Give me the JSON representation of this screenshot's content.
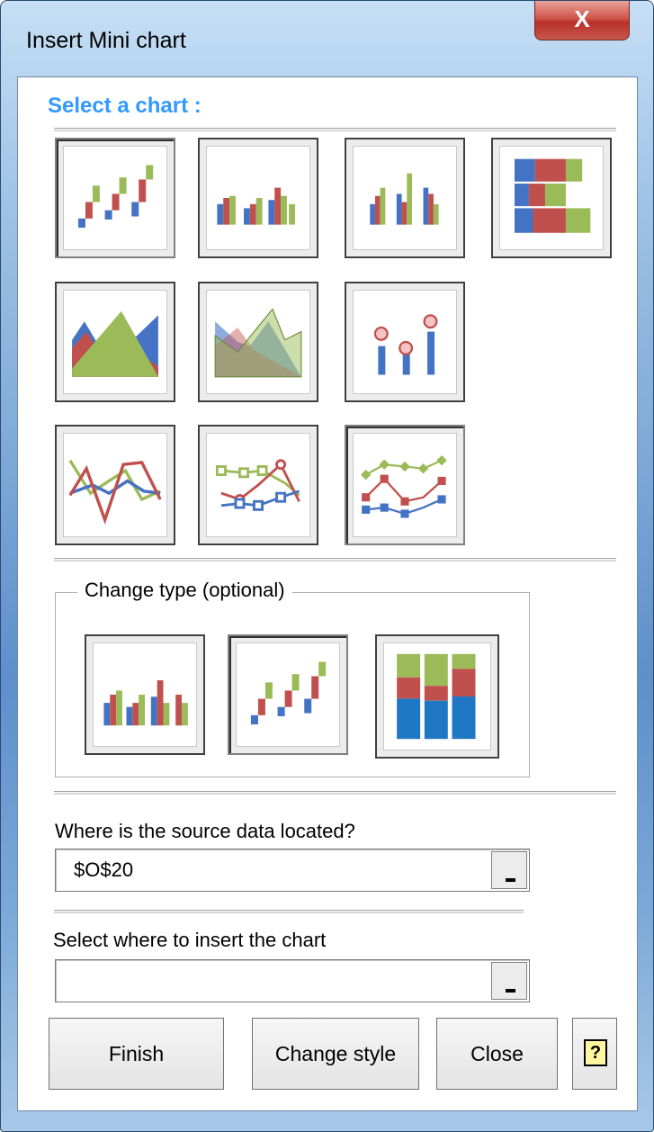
{
  "window": {
    "title": "Insert Mini chart",
    "close_glyph": "X"
  },
  "select_chart": {
    "label": "Select a chart :"
  },
  "chart_types": [
    {
      "name": "column-sparkline"
    },
    {
      "name": "clustered-column"
    },
    {
      "name": "clustered-column-2"
    },
    {
      "name": "stacked-bar"
    },
    {
      "name": "area"
    },
    {
      "name": "area-transparent"
    },
    {
      "name": "lollipop"
    },
    {
      "name": "line"
    },
    {
      "name": "line-markers"
    },
    {
      "name": "line-markers-filled"
    }
  ],
  "change_type": {
    "label": "Change type (optional)",
    "options": [
      {
        "name": "clustered-column"
      },
      {
        "name": "column-sparkline"
      },
      {
        "name": "stacked-column"
      }
    ]
  },
  "source": {
    "label": "Where is the source data located?",
    "value": "$O$20"
  },
  "insert": {
    "label": "Select where to insert the chart",
    "value": ""
  },
  "buttons": {
    "finish": "Finish",
    "change_style": "Change style",
    "close": "Close",
    "help_glyph": "?"
  },
  "colors": {
    "blue": "#4472c4",
    "red": "#c0504d",
    "green": "#9bbb59",
    "accent_title": "#3399ff"
  }
}
